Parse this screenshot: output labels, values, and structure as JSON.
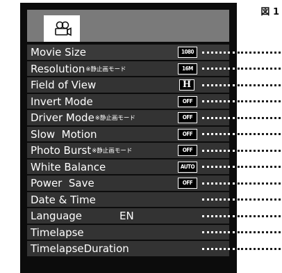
{
  "figure_label": "図 1",
  "header": {
    "icon": "video-camera-icon"
  },
  "menu_items": [
    {
      "label": "Movie Size",
      "note": "",
      "badge": "1080"
    },
    {
      "label": "Resolution",
      "note": "※静止画モード",
      "badge": "16M"
    },
    {
      "label": "Field of View",
      "note": "",
      "badge": "H"
    },
    {
      "label": "Invert Mode",
      "note": "",
      "badge": "OFF"
    },
    {
      "label": "Driver Mode",
      "note": "※静止画モード",
      "badge": "OFF"
    },
    {
      "label": "Slow  Motion",
      "note": "",
      "badge": "OFF"
    },
    {
      "label": "Photo Burst",
      "note": "※静止画モード",
      "badge": "OFF"
    },
    {
      "label": "White Balance",
      "note": "",
      "badge": "AUTO"
    },
    {
      "label": "Power  Save",
      "note": "",
      "badge": "OFF"
    },
    {
      "label": "Date & Time",
      "note": "",
      "badge": ""
    },
    {
      "label": "Language",
      "value": "EN",
      "note": "",
      "badge": ""
    },
    {
      "label": "Timelapse",
      "note": "",
      "badge": ""
    },
    {
      "label": "TimelapseDuration",
      "note": "",
      "badge": ""
    }
  ]
}
